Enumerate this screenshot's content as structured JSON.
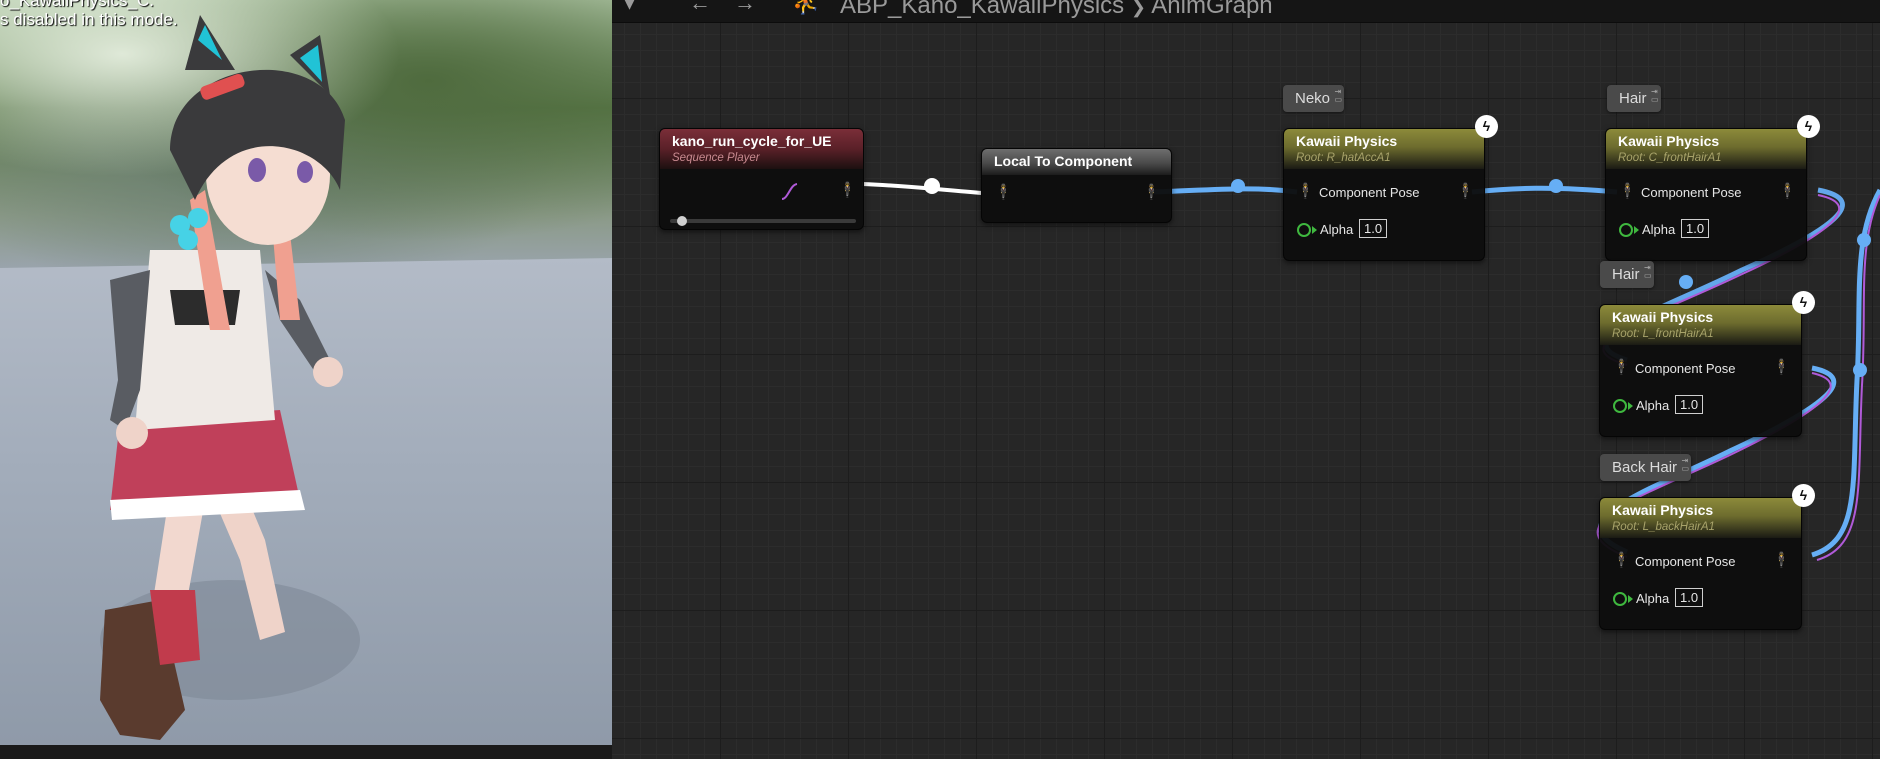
{
  "viewport": {
    "line1": "o_KawaiiPhysics_C.",
    "line2": "s disabled in this mode."
  },
  "toolbar": {
    "breadcrumb_asset": "ABP_Kano_KawaiiPhysics",
    "breadcrumb_sep": "❯",
    "breadcrumb_graph": "AnimGraph"
  },
  "nodes": {
    "sequence_player": {
      "title": "kano_run_cycle_for_UE",
      "subtitle": "Sequence Player"
    },
    "local_to_component": {
      "title": "Local To Component"
    },
    "kp1": {
      "comment": "Neko",
      "title": "Kawaii Physics",
      "root": "Root: R_hatAccA1",
      "pose": "Component Pose",
      "alpha_label": "Alpha",
      "alpha": "1.0"
    },
    "kp2": {
      "comment": "Hair",
      "title": "Kawaii Physics",
      "root": "Root: C_frontHairA1",
      "pose": "Component Pose",
      "alpha_label": "Alpha",
      "alpha": "1.0"
    },
    "kp3": {
      "comment": "Hair",
      "title": "Kawaii Physics",
      "root": "Root: L_frontHairA1",
      "pose": "Component Pose",
      "alpha_label": "Alpha",
      "alpha": "1.0"
    },
    "kp4": {
      "comment": "Back Hair",
      "title": "Kawaii Physics",
      "root": "Root: L_backHairA1",
      "pose": "Component Pose",
      "alpha_label": "Alpha",
      "alpha": "1.0"
    }
  },
  "colors": {
    "sequence_header": "#6e2a33",
    "kawaii_header": "#8c8a3a",
    "pose_wire": "#66aef5",
    "exec_wire": "#ffffff",
    "alpha_pin": "#3fb83f"
  }
}
